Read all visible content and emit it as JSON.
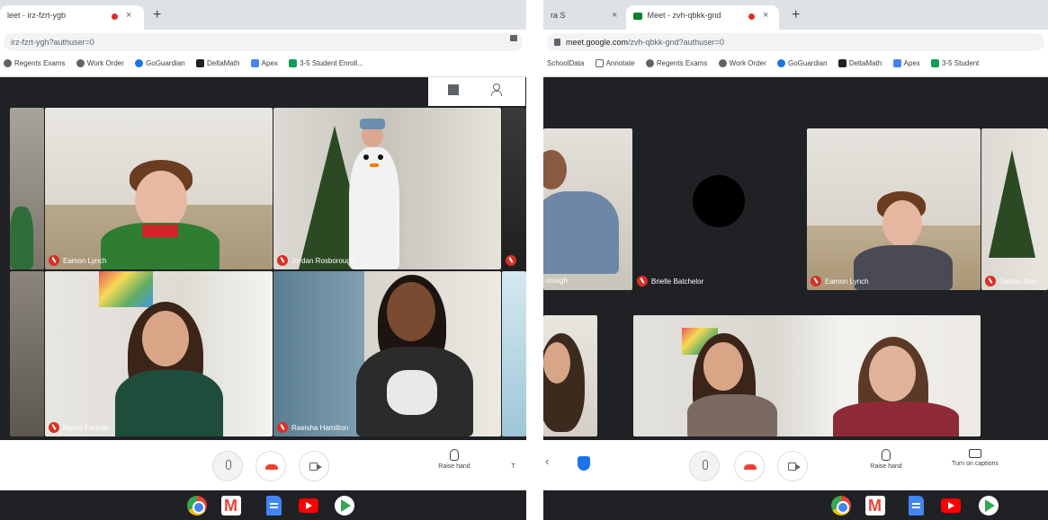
{
  "left": {
    "tab_title": "leet - irz-fzrt-ygb",
    "url": "irz-fzrt-ygh?authuser=0",
    "bookmarks": [
      "Regents Exams",
      "Work Order",
      "GoGuardian",
      "DeltaMath",
      "Apex",
      "3-5 Student Enroll..."
    ],
    "participants": [
      "Eamon Lynch",
      "Jordan Rosborough",
      "Nicole Forman",
      "Raeisha Hamilton"
    ],
    "raise_hand_label": "Raise hand",
    "overflow_label": "T"
  },
  "right": {
    "tab_inactive_title": "ra S",
    "tab_title": "Meet - zvh-qbkk-gnd",
    "url_host": "meet.google.com",
    "url_path": "/zvh-qbkk-gnd?authuser=0",
    "bookmarks": [
      "SchoolData",
      "Annotate",
      "Regents Exams",
      "Work Order",
      "GoGuardian",
      "DeltaMath",
      "Apex",
      "3-5 Student"
    ],
    "participants": [
      "orough",
      "Brielle Batchelor",
      "Eamon Lynch",
      "Jordan Ros"
    ],
    "raise_hand_label": "Raise hand",
    "captions_label": "Turn on captions"
  }
}
